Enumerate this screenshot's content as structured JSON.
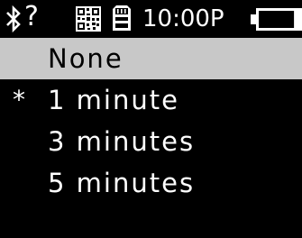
{
  "status_bar": {
    "bluetooth_icon": "bluetooth-icon",
    "unknown_indicator": "?",
    "qr_icon": "qr-code-icon",
    "sd_icon": "sd-card-icon",
    "time": "10:00P",
    "battery_icon": "battery-icon",
    "battery_level": 0.15
  },
  "menu": {
    "items": [
      {
        "label": "None",
        "marker": "",
        "selected": true
      },
      {
        "label": "1 minute",
        "marker": "*",
        "selected": false
      },
      {
        "label": "3 minutes",
        "marker": "",
        "selected": false
      },
      {
        "label": "5 minutes",
        "marker": "",
        "selected": false
      }
    ]
  },
  "colors": {
    "background": "#000000",
    "text": "#ffffff",
    "highlight": "#c8c8c8",
    "highlight_text": "#000000"
  }
}
